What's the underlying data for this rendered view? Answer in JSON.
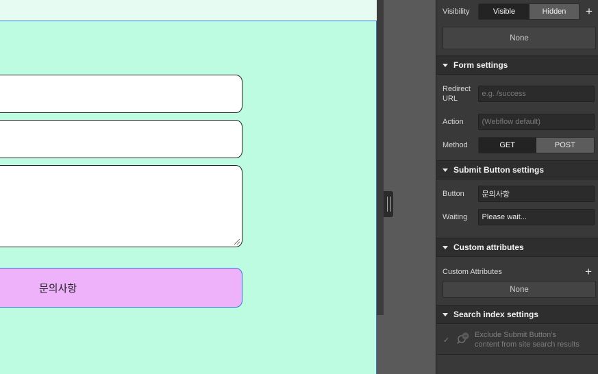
{
  "canvas": {
    "submit_button_text": "문의사항"
  },
  "panel": {
    "visibility": {
      "label": "Visibility",
      "visible": "Visible",
      "hidden": "Hidden",
      "add": "+",
      "value": "None"
    },
    "form_settings": {
      "title": "Form settings",
      "redirect_label": "Redirect URL",
      "redirect_placeholder": "e.g. /success",
      "action_label": "Action",
      "action_placeholder": "(Webflow default)",
      "method_label": "Method",
      "method_get": "GET",
      "method_post": "POST"
    },
    "submit_button_settings": {
      "title": "Submit Button settings",
      "button_label": "Button",
      "button_value": "문의사항",
      "waiting_label": "Waiting",
      "waiting_value": "Please wait..."
    },
    "custom_attributes": {
      "title": "Custom attributes",
      "label": "Custom Attributes",
      "add": "+",
      "value": "None"
    },
    "search_index": {
      "title": "Search index settings",
      "exclude_text_line1": "Exclude Submit Button's",
      "exclude_text_line2": "content from site search results"
    }
  },
  "colors": {
    "form_background": "#bdfce0",
    "submit_button": "#eeb2fb",
    "selection_outline": "#3a78d8",
    "panel_background": "#393939"
  }
}
